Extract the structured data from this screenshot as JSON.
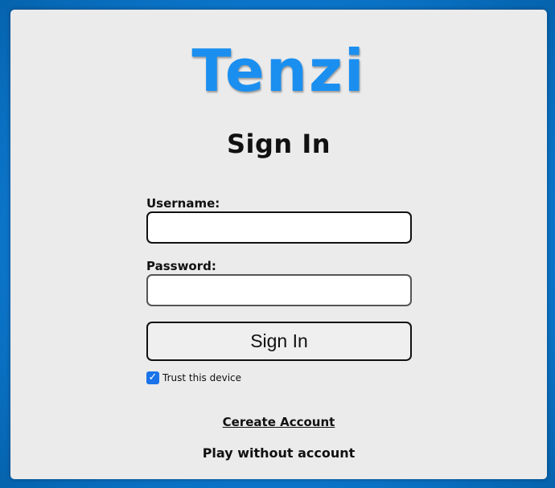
{
  "brand": {
    "logo_text": "Tenzi",
    "accent_color": "#1a8ff0",
    "background_color": "#0b74c8"
  },
  "signin": {
    "title": "Sign In",
    "username_label": "Username:",
    "username_value": "",
    "password_label": "Password:",
    "password_value": "",
    "submit_label": "Sign In",
    "trust_device_label": "Trust this device",
    "trust_device_checked": true
  },
  "links": {
    "create_account": "Cereate Account",
    "play_without_account": "Play without account"
  }
}
